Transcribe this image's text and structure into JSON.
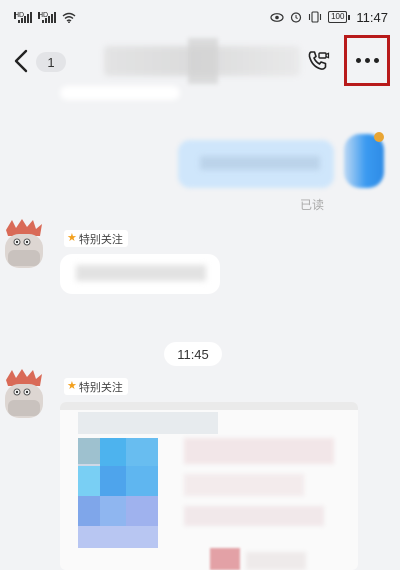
{
  "status_bar": {
    "time": "11:47",
    "battery": "100",
    "hd1": "HD",
    "hd2": "HD"
  },
  "header": {
    "unread_count": "1"
  },
  "chat": {
    "sent_status": "已读",
    "tag_label": "特别关注",
    "time_divider": "11:45"
  },
  "colors": {
    "highlight_border": "#b81a1a",
    "sent_bubble": "#cfe6fb",
    "tag_star": "#f3a01d"
  }
}
